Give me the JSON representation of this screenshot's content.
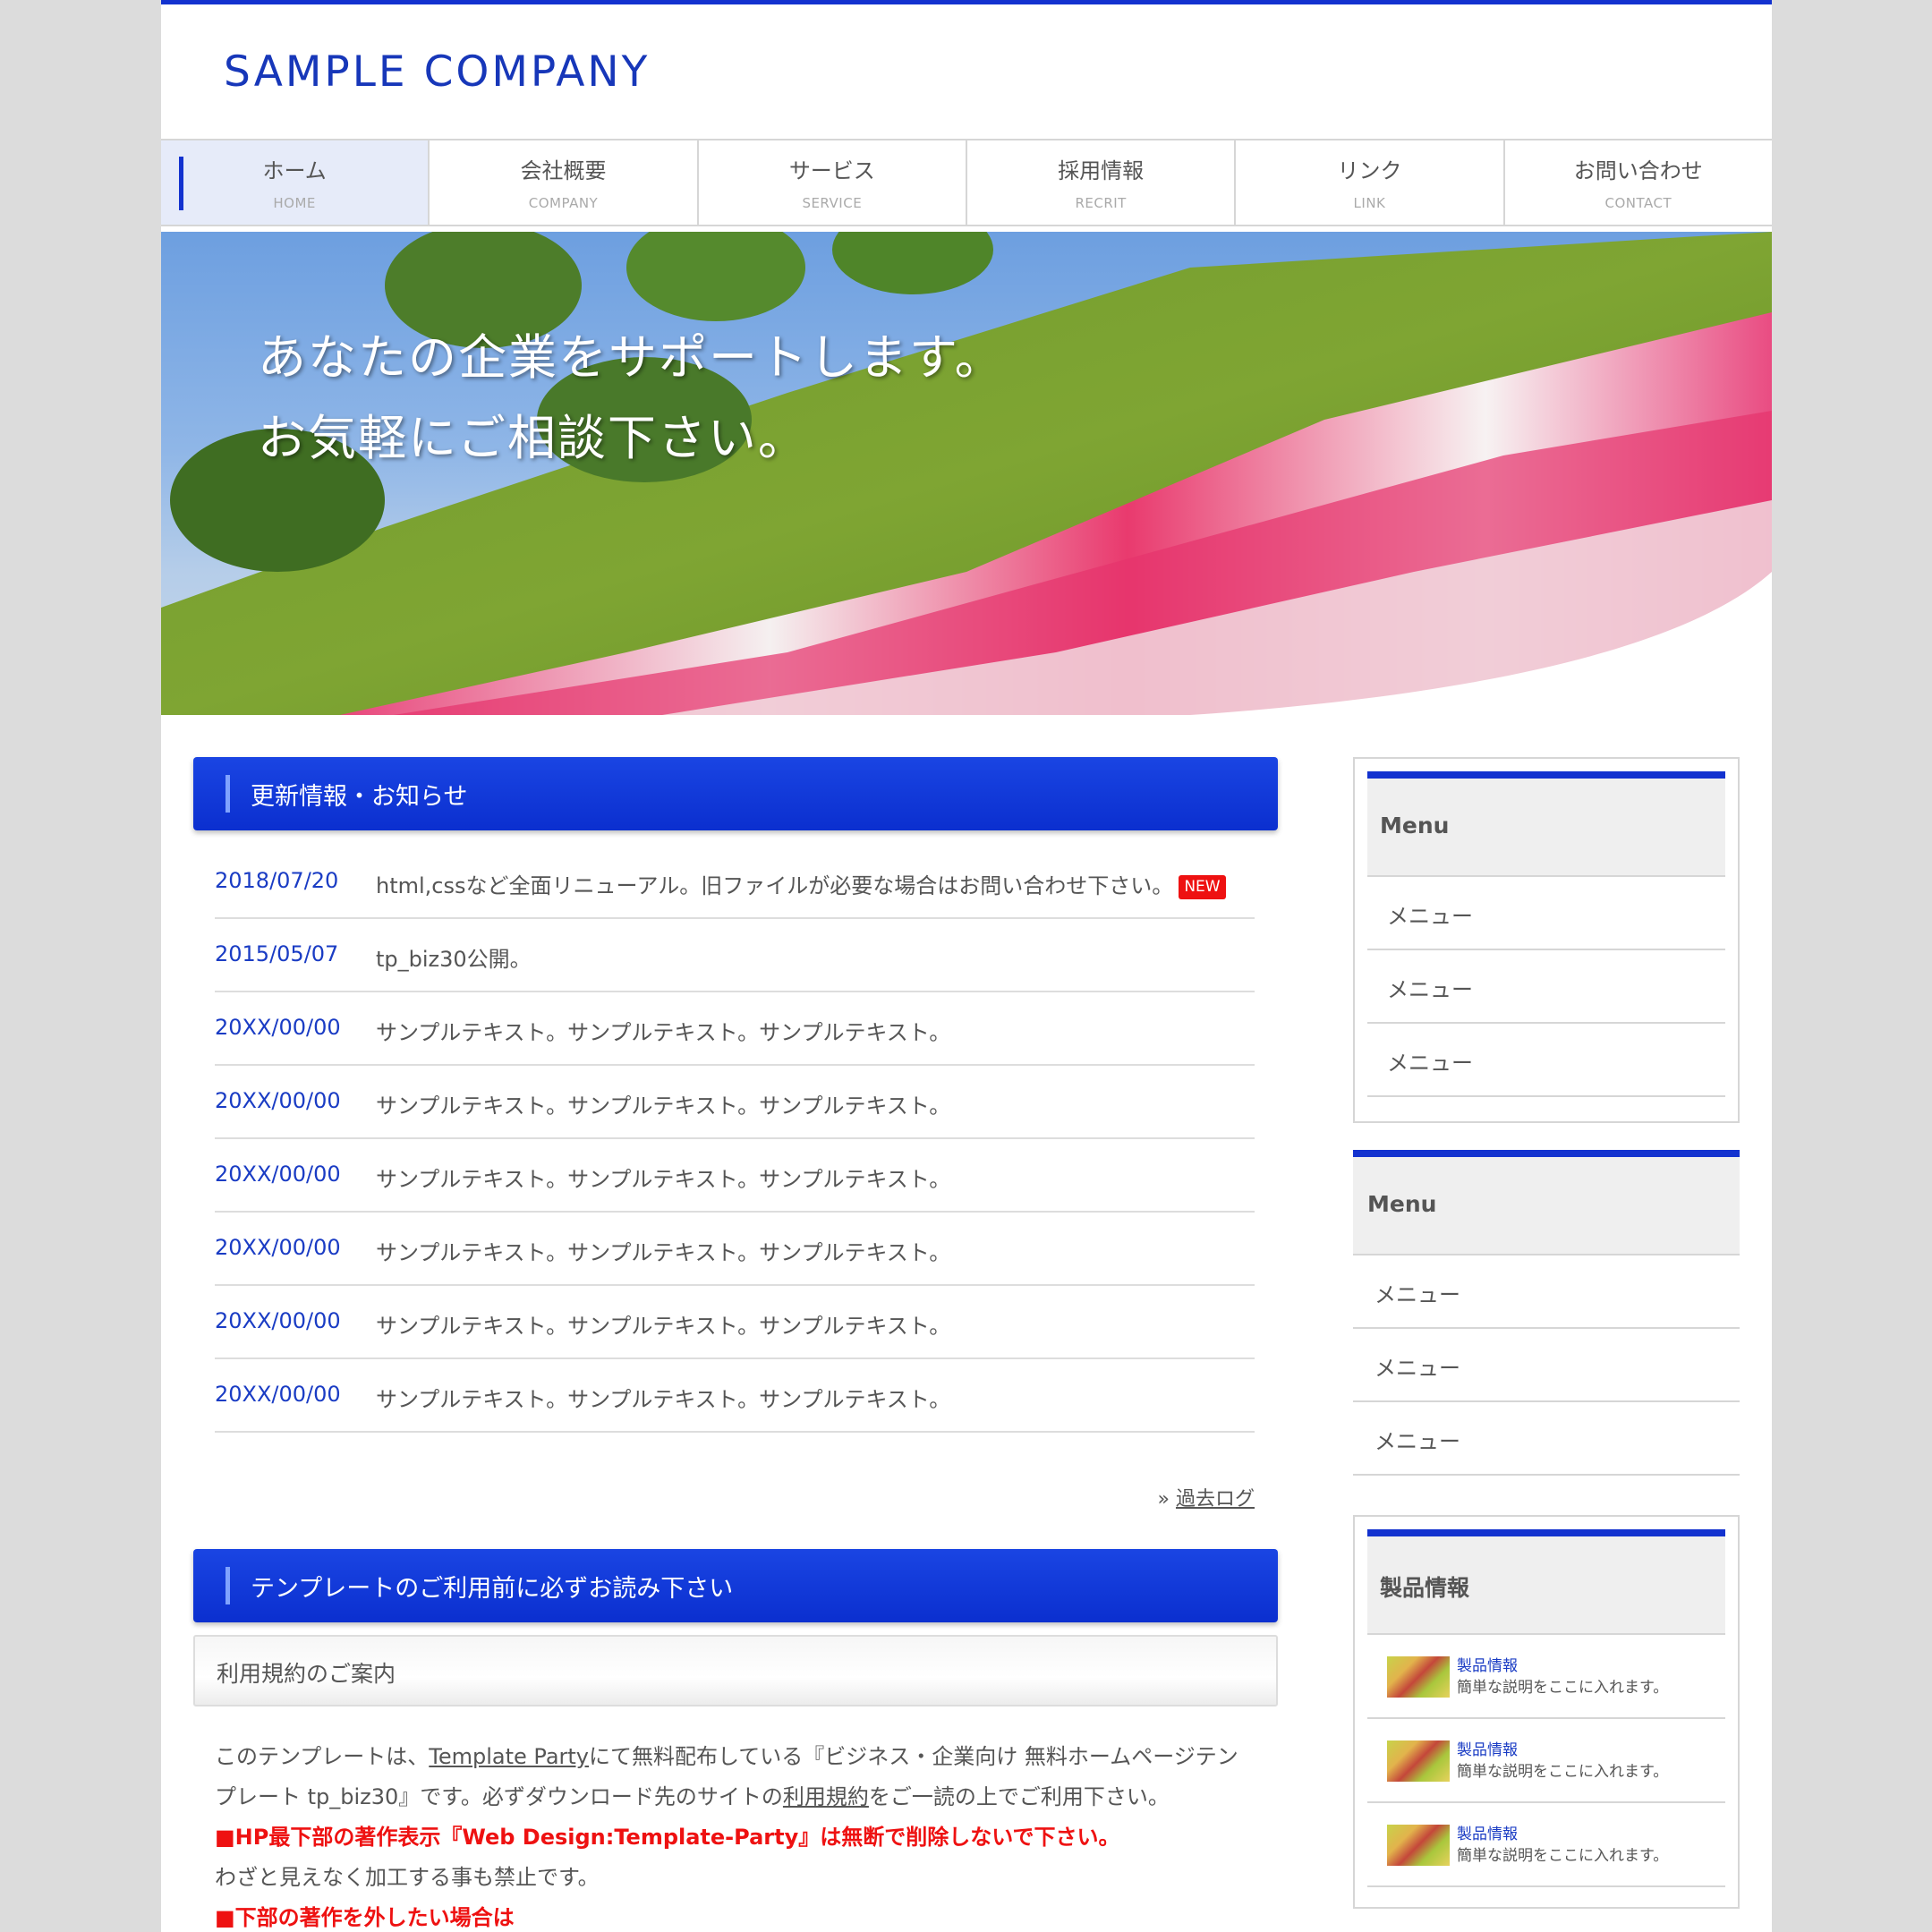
{
  "header": {
    "logo": "SAMPLE COMPANY"
  },
  "nav": [
    {
      "jp": "ホーム",
      "en": "HOME"
    },
    {
      "jp": "会社概要",
      "en": "COMPANY"
    },
    {
      "jp": "サービス",
      "en": "SERVICE"
    },
    {
      "jp": "採用情報",
      "en": "RECRIT"
    },
    {
      "jp": "リンク",
      "en": "LINK"
    },
    {
      "jp": "お問い合わせ",
      "en": "CONTACT"
    }
  ],
  "hero": {
    "line1": "あなたの企業をサポートします。",
    "line2": "お気軽にご相談下さい。"
  },
  "news": {
    "title": "更新情報・お知らせ",
    "items": [
      {
        "date": "2018/07/20",
        "text": "html,cssなど全面リニューアル。旧ファイルが必要な場合はお問い合わせ下さい。",
        "badge": "NEW"
      },
      {
        "date": "2015/05/07",
        "text": "tp_biz30公開。"
      },
      {
        "date": "20XX/00/00",
        "text": "サンプルテキスト。サンプルテキスト。サンプルテキスト。"
      },
      {
        "date": "20XX/00/00",
        "text": "サンプルテキスト。サンプルテキスト。サンプルテキスト。"
      },
      {
        "date": "20XX/00/00",
        "text": "サンプルテキスト。サンプルテキスト。サンプルテキスト。"
      },
      {
        "date": "20XX/00/00",
        "text": "サンプルテキスト。サンプルテキスト。サンプルテキスト。"
      },
      {
        "date": "20XX/00/00",
        "text": "サンプルテキスト。サンプルテキスト。サンプルテキスト。"
      },
      {
        "date": "20XX/00/00",
        "text": "サンプルテキスト。サンプルテキスト。サンプルテキスト。"
      }
    ],
    "past_prefix": "»",
    "past_label": "過去ログ"
  },
  "notice": {
    "title": "テンプレートのご利用前に必ずお読み下さい",
    "subtitle": "利用規約のご案内",
    "para1_a": "このテンプレートは、",
    "para1_link": "Template Party",
    "para1_b": "にて無料配布している『ビジネス・企業向け 無料ホームページテンプレート tp_biz30』です。必ずダウンロード先のサイトの",
    "para1_link2": "利用規約",
    "para1_c": "をご一読の上でご利用下さい。",
    "warn1": "■HP最下部の著作表示『Web Design:Template-Party』は無断で削除しないで下さい。",
    "para2": "わざと見えなく加工する事も禁止です。",
    "warn2": "■下部の著作を外したい場合は"
  },
  "sidebar": {
    "menu1": {
      "title": "Menu",
      "items": [
        "メニュー",
        "メニュー",
        "メニュー"
      ]
    },
    "menu2": {
      "title": "Menu",
      "items": [
        "メニュー",
        "メニュー",
        "メニュー"
      ]
    },
    "products": {
      "title": "製品情報",
      "items": [
        {
          "title": "製品情報",
          "desc": "簡単な説明をここに入れます。"
        },
        {
          "title": "製品情報",
          "desc": "簡単な説明をここに入れます。"
        },
        {
          "title": "製品情報",
          "desc": "簡単な説明をここに入れます。"
        }
      ]
    }
  },
  "colors": {
    "accent": "#1332cf",
    "link": "#1a3cc4",
    "warn": "#ee1111",
    "background": "#dcdcdc"
  }
}
